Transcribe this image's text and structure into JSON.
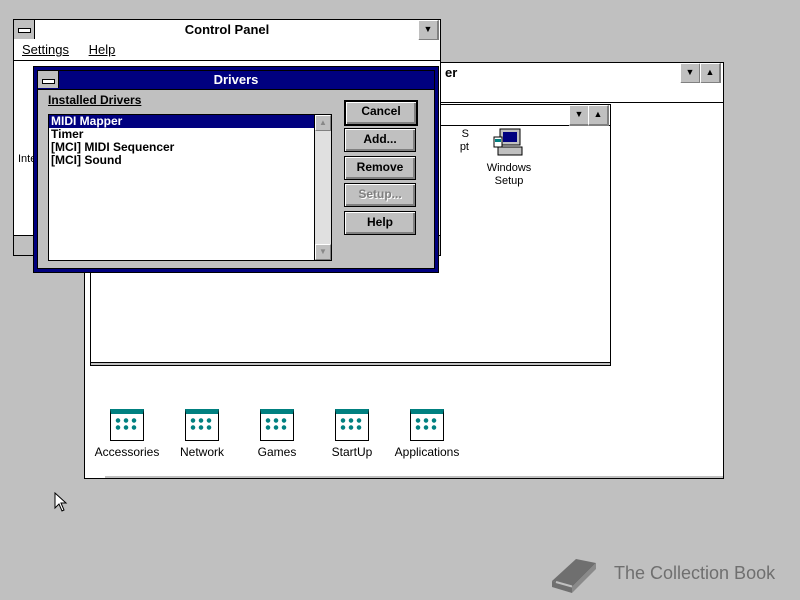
{
  "program_manager": {
    "title_fragment": "er",
    "groups": [
      {
        "label": "Accessories"
      },
      {
        "label": "Network"
      },
      {
        "label": "Games"
      },
      {
        "label": "StartUp"
      },
      {
        "label": "Applications"
      }
    ]
  },
  "main_group": {
    "icons": [
      {
        "label": "Windows\nSetup"
      },
      {
        "label": "S\npt"
      }
    ]
  },
  "control_panel": {
    "title": "Control Panel",
    "menu": {
      "settings": "Settings",
      "help": "Help"
    },
    "partial_icon_label": "Inte"
  },
  "drivers_dialog": {
    "title": "Drivers",
    "installed_label": "Installed Drivers",
    "drivers": [
      {
        "name": "MIDI Mapper",
        "selected": true
      },
      {
        "name": "Timer",
        "selected": false
      },
      {
        "name": "[MCI] MIDI Sequencer",
        "selected": false
      },
      {
        "name": "[MCI] Sound",
        "selected": false
      }
    ],
    "buttons": {
      "cancel": "Cancel",
      "add": "Add...",
      "remove": "Remove",
      "setup": "Setup...",
      "help": "Help"
    }
  },
  "watermark": {
    "text": "The Collection Book"
  },
  "colors": {
    "titlebar_active": "#00007f",
    "desktop": "#c0c0c0",
    "selection": "#00007f"
  }
}
